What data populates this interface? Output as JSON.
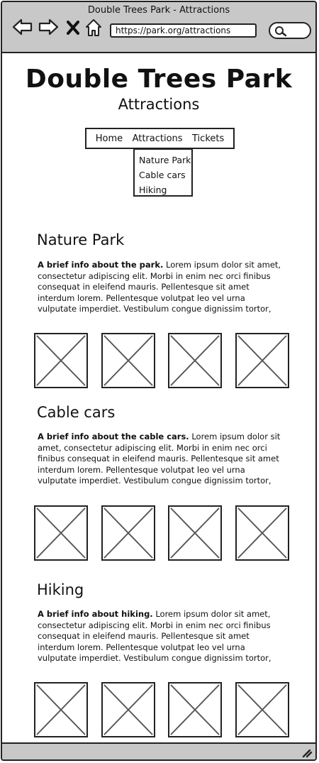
{
  "window": {
    "title": "Double Trees Park - Attractions",
    "url": "https://park.org/attractions"
  },
  "header": {
    "title": "Double Trees Park",
    "subtitle": "Attractions"
  },
  "menu": {
    "items": [
      "Home",
      "Attractions",
      "Tickets"
    ],
    "dropdown": [
      "Nature Park",
      "Cable cars",
      "Hiking"
    ]
  },
  "sections": [
    {
      "title": "Nature Park",
      "lead": "A brief info about the park.",
      "body": " Lorem ipsum dolor sit amet, consectetur adipiscing elit. Morbi in enim nec orci finibus consequat in eleifend mauris. Pellentesque sit amet interdum lorem. Pellentesque volutpat leo vel urna vulputate imperdiet. Vestibulum congue dignissim tortor,"
    },
    {
      "title": "Cable cars",
      "lead": "A brief info about the cable cars.",
      "body": " Lorem ipsum dolor sit amet, consectetur adipiscing elit. Morbi in enim nec orci finibus consequat in eleifend mauris. Pellentesque sit amet interdum lorem. Pellentesque volutpat leo vel urna vulputate imperdiet. Vestibulum congue dignissim tortor,"
    },
    {
      "title": "Hiking",
      "lead": "A brief info about hiking.",
      "body": " Lorem ipsum dolor sit amet, consectetur adipiscing elit. Morbi in enim nec orci finibus consequat in eleifend mauris. Pellentesque sit amet interdum lorem. Pellentesque volutpat leo vel urna vulputate imperdiet. Vestibulum congue dignissim tortor,"
    }
  ],
  "icons": {
    "back": "back-arrow-icon",
    "forward": "forward-arrow-icon",
    "stop": "close-icon",
    "home": "home-icon",
    "search": "search-icon",
    "image": "image-placeholder-icon",
    "resize": "resize-grip-icon"
  }
}
